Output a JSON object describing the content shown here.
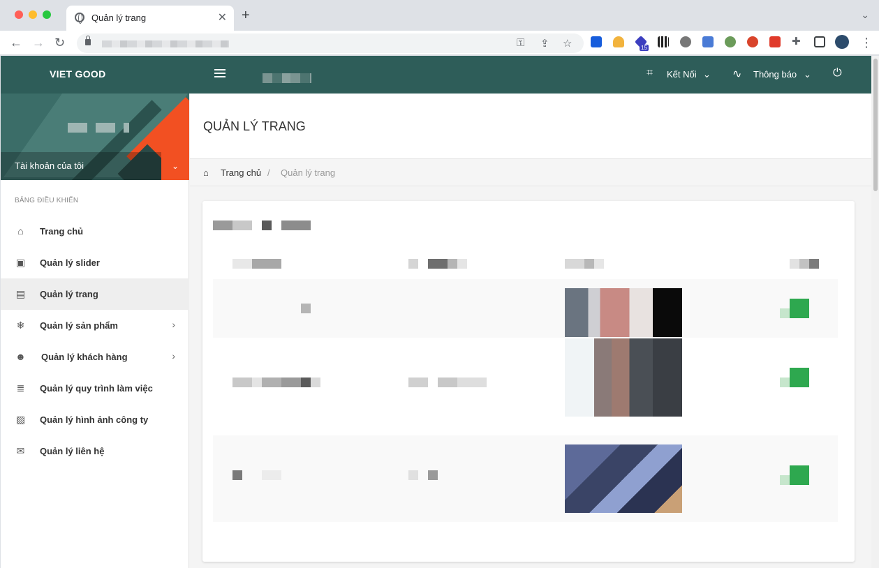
{
  "browser": {
    "tab_title": "Quản lý trang",
    "tab_close": "✕",
    "new_tab": "+",
    "tab_menu": "⌄",
    "extension_badge": "15"
  },
  "header": {
    "brand": "VIET GOOD",
    "connect_label": "Kết Nối",
    "notify_label": "Thông báo"
  },
  "sidebar": {
    "account_label": "Tài khoản của tôi",
    "section_title": "BẢNG ĐIỀU KHIỂN",
    "items": [
      {
        "label": "Trang chủ",
        "icon": "home-icon"
      },
      {
        "label": "Quản lý slider",
        "icon": "image-icon"
      },
      {
        "label": "Quản lý trang",
        "icon": "page-icon",
        "active": true
      },
      {
        "label": "Quản lý sản phẩm",
        "icon": "snowflake-icon",
        "has_children": true
      },
      {
        "label": "Quản lý khách hàng",
        "icon": "customer-icon",
        "has_children": true
      },
      {
        "label": "Quản lý quy trình làm việc",
        "icon": "workflow-icon"
      },
      {
        "label": "Quản lý hình ảnh công ty",
        "icon": "gallery-icon"
      },
      {
        "label": "Quản lý liên hệ",
        "icon": "mail-icon"
      }
    ]
  },
  "page": {
    "title": "QUẢN LÝ TRANG",
    "breadcrumb_home": "Trang chủ",
    "breadcrumb_sep": "/",
    "breadcrumb_current": "Quản lý trang"
  },
  "colors": {
    "header_bg": "#2e5d59",
    "accent": "#f25022",
    "status_green": "#2ea84f"
  }
}
